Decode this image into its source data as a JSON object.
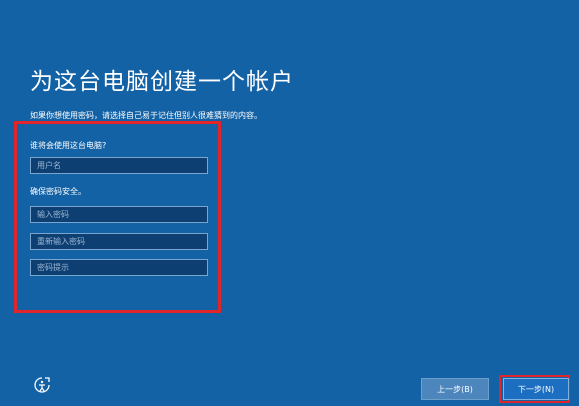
{
  "page": {
    "title": "为这台电脑创建一个帐户",
    "subtitle": "如果你想使用密码，请选择自己易于记住但别人很难猜到的内容。"
  },
  "form": {
    "who_label": "谁将会使用这台电脑?",
    "username_placeholder": "用户名",
    "password_label": "确保密码安全。",
    "password_placeholder": "输入密码",
    "confirm_placeholder": "重新输入密码",
    "hint_placeholder": "密码提示"
  },
  "footer": {
    "accessibility_icon": "accessibility-icon",
    "back_label": "上一步(B)",
    "next_label": "下一步(N)"
  },
  "colors": {
    "background": "#1462a6",
    "highlight": "#e0262b",
    "field_bg": "#0e3f72"
  }
}
